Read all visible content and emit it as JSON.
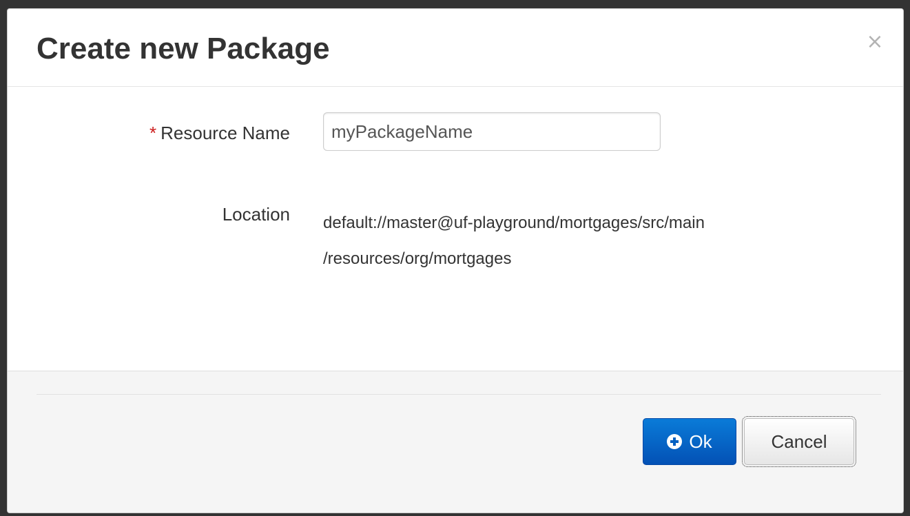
{
  "dialog": {
    "title": "Create new Package",
    "close_label": "×"
  },
  "form": {
    "resource_name": {
      "required_marker": "*",
      "label": "Resource Name",
      "value": "myPackageName"
    },
    "location": {
      "label": "Location",
      "value_line1": "default://master@uf-playground/mortgages/src/main",
      "value_line2": "/resources/org/mortgages"
    }
  },
  "footer": {
    "ok_label": "Ok",
    "ok_icon": "plus-circle-icon",
    "cancel_label": "Cancel"
  },
  "colors": {
    "primary": "#0461c2",
    "required": "#cc1d1d",
    "text": "#333333"
  }
}
